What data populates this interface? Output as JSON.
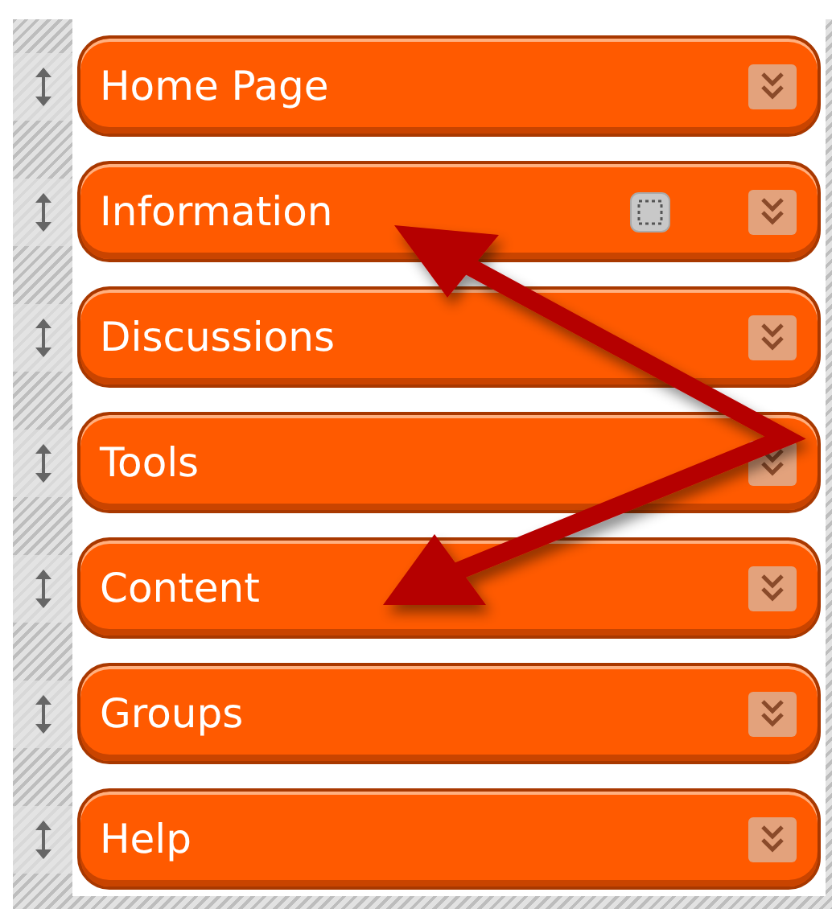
{
  "menu_items": [
    {
      "label": "Home Page",
      "extra_icon": false
    },
    {
      "label": "Information",
      "extra_icon": true
    },
    {
      "label": "Discussions",
      "extra_icon": false
    },
    {
      "label": "Tools",
      "extra_icon": false
    },
    {
      "label": "Content",
      "extra_icon": false
    },
    {
      "label": "Groups",
      "extra_icon": false
    },
    {
      "label": "Help",
      "extra_icon": false
    }
  ]
}
